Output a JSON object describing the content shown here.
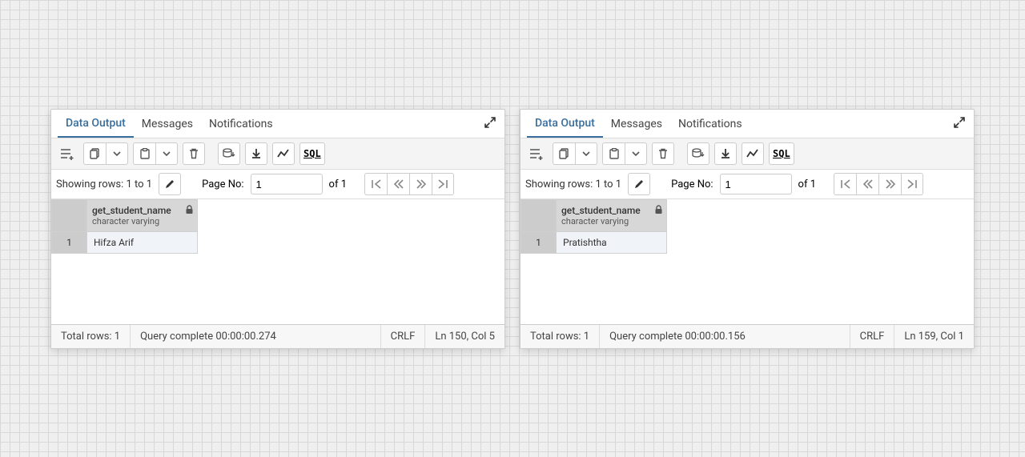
{
  "panels": [
    {
      "tabs": {
        "data_output": "Data Output",
        "messages": "Messages",
        "notifications": "Notifications"
      },
      "pager": {
        "rows_label": "Showing rows: 1 to 1",
        "page_no_label": "Page No:",
        "page_no_value": "1",
        "of_label": "of 1"
      },
      "column": {
        "name": "get_student_name",
        "type": "character varying"
      },
      "row": {
        "num": "1",
        "value": "Hifza Arif"
      },
      "status": {
        "total_rows": "Total rows: 1",
        "query": "Query complete 00:00:00.274",
        "crlf": "CRLF",
        "pos": "Ln 150, Col 5"
      },
      "sql_label": "SQL"
    },
    {
      "tabs": {
        "data_output": "Data Output",
        "messages": "Messages",
        "notifications": "Notifications"
      },
      "pager": {
        "rows_label": "Showing rows: 1 to 1",
        "page_no_label": "Page No:",
        "page_no_value": "1",
        "of_label": "of 1"
      },
      "column": {
        "name": "get_student_name",
        "type": "character varying"
      },
      "row": {
        "num": "1",
        "value": "Pratishtha"
      },
      "status": {
        "total_rows": "Total rows: 1",
        "query": "Query complete 00:00:00.156",
        "crlf": "CRLF",
        "pos": "Ln 159, Col 1"
      },
      "sql_label": "SQL"
    }
  ]
}
